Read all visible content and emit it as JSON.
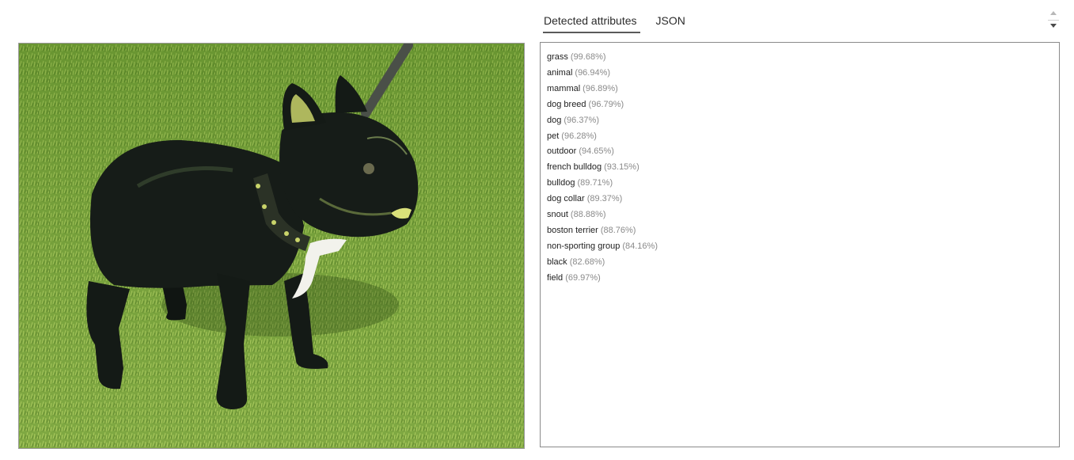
{
  "tabs": [
    {
      "label": "Detected attributes",
      "active": true
    },
    {
      "label": "JSON",
      "active": false
    }
  ],
  "image": {
    "subject": "black french bulldog on grass with leash",
    "colors": {
      "grass": "#6d9a34",
      "grass_light": "#a7c85a",
      "dog": "#141a16",
      "dog_highlight": "#c9d46a",
      "chest": "#f2f2ec",
      "leash": "#4a4f48"
    }
  },
  "attributes": [
    {
      "name": "grass",
      "score": "(99.68%)"
    },
    {
      "name": "animal",
      "score": "(96.94%)"
    },
    {
      "name": "mammal",
      "score": "(96.89%)"
    },
    {
      "name": "dog breed",
      "score": "(96.79%)"
    },
    {
      "name": "dog",
      "score": "(96.37%)"
    },
    {
      "name": "pet",
      "score": "(96.28%)"
    },
    {
      "name": "outdoor",
      "score": "(94.65%)"
    },
    {
      "name": "french bulldog",
      "score": "(93.15%)"
    },
    {
      "name": "bulldog",
      "score": "(89.71%)"
    },
    {
      "name": "dog collar",
      "score": "(89.37%)"
    },
    {
      "name": "snout",
      "score": "(88.88%)"
    },
    {
      "name": "boston terrier",
      "score": "(88.76%)"
    },
    {
      "name": "non-sporting group",
      "score": "(84.16%)"
    },
    {
      "name": "black",
      "score": "(82.68%)"
    },
    {
      "name": "field",
      "score": "(69.97%)"
    }
  ]
}
